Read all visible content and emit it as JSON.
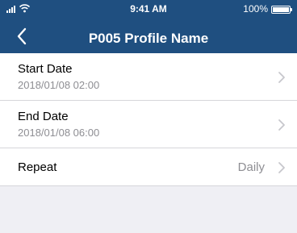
{
  "status_bar": {
    "time": "9:41 AM",
    "battery": "100%"
  },
  "nav": {
    "title": "P005 Profile Name"
  },
  "rows": [
    {
      "label": "Start Date",
      "value": "2018/01/08 02:00"
    },
    {
      "label": "End Date",
      "value": "2018/01/08 06:00"
    },
    {
      "label": "Repeat",
      "value": "Daily"
    }
  ],
  "colors": {
    "header": "#1f4f80",
    "background": "#efeff4",
    "secondary_text": "#8e8e93"
  }
}
